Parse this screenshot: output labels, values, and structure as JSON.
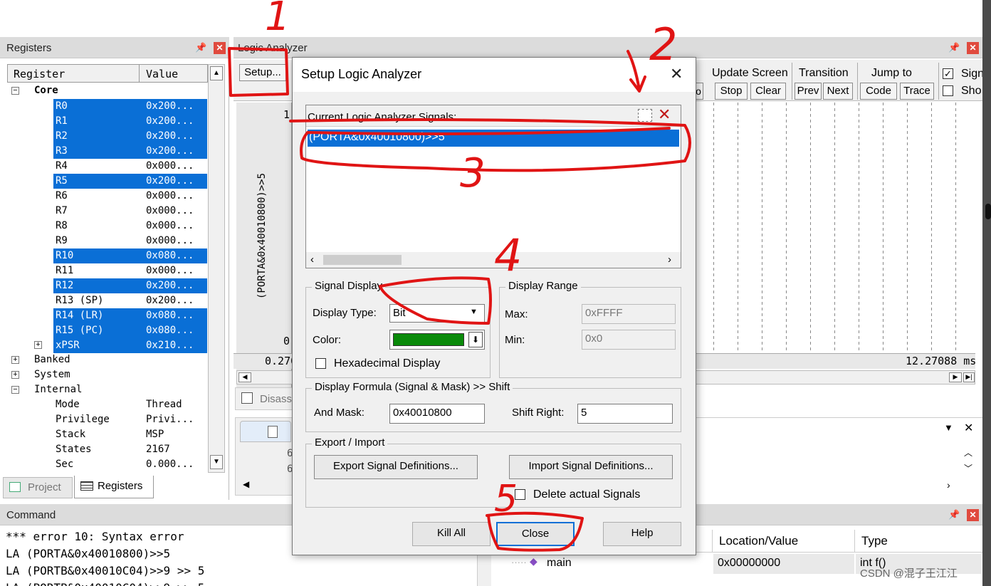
{
  "annotations": {
    "n1": "1",
    "n2": "2",
    "n3": "3",
    "n4": "4",
    "n5": "5"
  },
  "registers": {
    "title": "Registers",
    "col_register": "Register",
    "col_value": "Value",
    "core_label": "Core",
    "rows": [
      {
        "name": "R0",
        "value": "0x200...",
        "sel": true
      },
      {
        "name": "R1",
        "value": "0x200...",
        "sel": true
      },
      {
        "name": "R2",
        "value": "0x200...",
        "sel": true
      },
      {
        "name": "R3",
        "value": "0x200...",
        "sel": true
      },
      {
        "name": "R4",
        "value": "0x000...",
        "sel": false
      },
      {
        "name": "R5",
        "value": "0x200...",
        "sel": true
      },
      {
        "name": "R6",
        "value": "0x000...",
        "sel": false
      },
      {
        "name": "R7",
        "value": "0x000...",
        "sel": false
      },
      {
        "name": "R8",
        "value": "0x000...",
        "sel": false
      },
      {
        "name": "R9",
        "value": "0x000...",
        "sel": false
      },
      {
        "name": "R10",
        "value": "0x080...",
        "sel": true
      },
      {
        "name": "R11",
        "value": "0x000...",
        "sel": false
      },
      {
        "name": "R12",
        "value": "0x200...",
        "sel": true
      },
      {
        "name": "R13 (SP)",
        "value": "0x200...",
        "sel": false
      },
      {
        "name": "R14 (LR)",
        "value": "0x080...",
        "sel": true
      },
      {
        "name": "R15 (PC)",
        "value": "0x080...",
        "sel": true
      },
      {
        "name": "xPSR",
        "value": "0x210...",
        "sel": true
      }
    ],
    "banked": "Banked",
    "system": "System",
    "internal": "Internal",
    "internal_rows": [
      {
        "name": "Mode",
        "value": "Thread"
      },
      {
        "name": "Privilege",
        "value": "Privi..."
      },
      {
        "name": "Stack",
        "value": "MSP"
      },
      {
        "name": "States",
        "value": "2167"
      },
      {
        "name": "Sec",
        "value": "0.000..."
      }
    ],
    "tab_project": "Project",
    "tab_registers": "Registers"
  },
  "logic": {
    "title": "Logic Analyzer",
    "setup_btn": "Setup...",
    "update_screen": "Update Screen",
    "stop": "Stop",
    "clear": "Clear",
    "transition": "Transition",
    "prev": "Prev",
    "next": "Next",
    "jump_to": "Jump to",
    "code": "Code",
    "trace": "Trace",
    "sig": "Sign",
    "sho": "Sho",
    "y_top": "1",
    "y_bottom": "0",
    "signal_label": "(PORTA&0x40010800)>>5",
    "time_left": "0.270",
    "time_right": "12.27088 ms",
    "disass": "Disass"
  },
  "command": {
    "title": "Command",
    "lines": [
      "*** error 10: Syntax error",
      "LA (PORTA&0x40010800)>>5",
      "LA (PORTB&0x40010C04)>>9 >> 5",
      "LA (PORTB&0x40010C04)>>9 >> 5"
    ]
  },
  "watch": {
    "col_location": "Location/Value",
    "col_type": "Type",
    "row_name": "main",
    "row_value": "0x00000000",
    "row_type": "int f()"
  },
  "dialog": {
    "title": "Setup Logic Analyzer",
    "current_signals": "Current Logic Analyzer Signals:",
    "signal": "(PORTA&0x40010800)>>5",
    "signal_display": "Signal Display",
    "display_type_label": "Display Type:",
    "display_type": "Bit",
    "color_label": "Color:",
    "color": "#0a8a0a",
    "hex_display": "Hexadecimal Display",
    "display_range": "Display Range",
    "max_label": "Max:",
    "max": "0xFFFF",
    "min_label": "Min:",
    "min": "0x0",
    "formula": "Display Formula (Signal & Mask) >> Shift",
    "and_mask_label": "And Mask:",
    "and_mask": "0x40010800",
    "shift_right_label": "Shift Right:",
    "shift_right": "5",
    "export_import": "Export / Import",
    "export_btn": "Export Signal Definitions...",
    "import_btn": "Import Signal Definitions...",
    "delete_actual": "Delete actual Signals",
    "kill_all": "Kill All",
    "close": "Close",
    "help": "Help"
  },
  "watermark": "CSDN @混子王江江"
}
